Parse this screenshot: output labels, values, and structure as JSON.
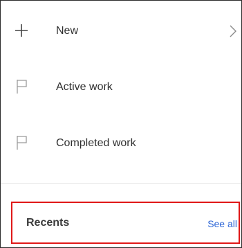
{
  "menu": {
    "items": [
      {
        "label": "New",
        "icon": "plus-icon",
        "has_chevron": true
      },
      {
        "label": "Active work",
        "icon": "flag-icon"
      },
      {
        "label": "Completed work",
        "icon": "flag-icon"
      }
    ]
  },
  "recents": {
    "title": "Recents",
    "see_all_label": "See all",
    "highlight_color": "#e01818",
    "link_color": "#2d66d7"
  }
}
